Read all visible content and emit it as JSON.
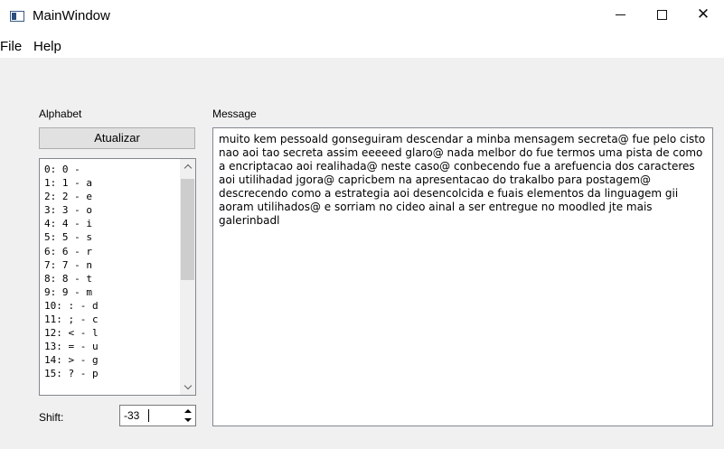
{
  "window": {
    "title": "MainWindow",
    "minimize_glyph": "",
    "maximize_glyph": "",
    "close_glyph": "✕"
  },
  "menu": {
    "file": "File",
    "help": "Help"
  },
  "alphabet": {
    "label": "Alphabet",
    "update_button": "Atualizar",
    "items": [
      "0: 0 -",
      "1: 1 - a",
      "2: 2 - e",
      "3: 3 - o",
      "4: 4 - i",
      "5: 5 - s",
      "6: 6 - r",
      "7: 7 - n",
      "8: 8 - t",
      "9: 9 - m",
      "10: : - d",
      "11: ; - c",
      "12: < - l",
      "13: = - u",
      "14: > - g",
      "15: ? - p"
    ]
  },
  "shift": {
    "label": "Shift:",
    "value": "-33"
  },
  "message": {
    "label": "Message",
    "text": "muito kem pessoald gonseguiram descendar a minba mensagem secreta@ fue pelo cisto nao aoi tao secreta assim eeeeed glaro@ nada melbor do fue termos uma pista de como a encriptacao aoi realihada@ neste caso@ conbecendo fue a arefuencia dos caracteres aoi utilihadad jgora@ capricbem na apresentacao do trakalbo para postagem@ descrecendo como a estrategia aoi desencolcida e fuais elementos da linguagem gii aoram utilihados@ e sorriam no cideo ainal a ser entregue no moodled jte mais galerinbadl"
  },
  "icons": {
    "app": "window-app-icon",
    "minimize": "minimize-icon",
    "maximize": "maximize-icon",
    "close": "close-icon",
    "scroll_up": "chevron-up-icon",
    "scroll_down": "chevron-down-icon",
    "spin_up": "triangle-up-icon",
    "spin_down": "triangle-down-icon"
  }
}
